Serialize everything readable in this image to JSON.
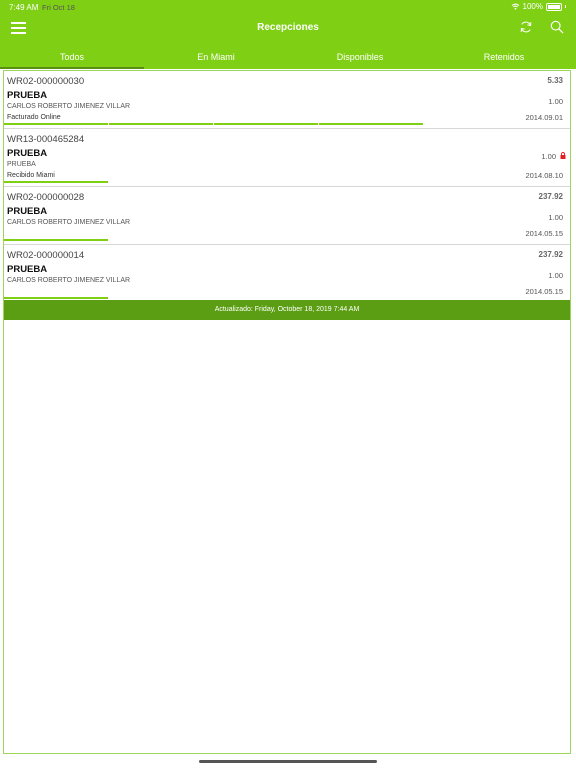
{
  "status_bar": {
    "time": "7:49 AM",
    "date": "Fri Oct 18",
    "battery": "100%"
  },
  "header": {
    "title": "Recepciones"
  },
  "tabs": [
    {
      "label": "Todos",
      "active": true
    },
    {
      "label": "En Miami",
      "active": false
    },
    {
      "label": "Disponibles",
      "active": false
    },
    {
      "label": "Retenidos",
      "active": false
    }
  ],
  "rows": [
    {
      "wr": "WR02-000000030",
      "name": "PRUEBA",
      "client": "CARLOS ROBERTO JIMENEZ VILLAR",
      "status": "Facturado Online",
      "amount": "5.33",
      "qty": "1.00",
      "date": "2014.09.01",
      "progress_steps": 4,
      "locked": false
    },
    {
      "wr": "WR13-000465284",
      "name": "PRUEBA",
      "client": "PRUEBA",
      "status": "Recibido  Miami",
      "amount": "",
      "qty": "1.00",
      "date": "2014.08.10",
      "progress_steps": 1,
      "locked": true
    },
    {
      "wr": "WR02-000000028",
      "name": "PRUEBA",
      "client": "CARLOS ROBERTO JIMENEZ VILLAR",
      "status": "",
      "amount": "237.92",
      "qty": "1.00",
      "date": "2014.05.15",
      "progress_steps": 1,
      "locked": false
    },
    {
      "wr": "WR02-000000014",
      "name": "PRUEBA",
      "client": "CARLOS ROBERTO JIMENEZ VILLAR",
      "status": "",
      "amount": "237.92",
      "qty": "1.00",
      "date": "2014.05.15",
      "progress_steps": 1,
      "locked": false
    }
  ],
  "updated": "Actualizado: Friday, October 18, 2019 7:44 AM",
  "colors": {
    "accent": "#7fcf15",
    "dark_accent": "#5c9e13",
    "lock": "#e02020"
  }
}
